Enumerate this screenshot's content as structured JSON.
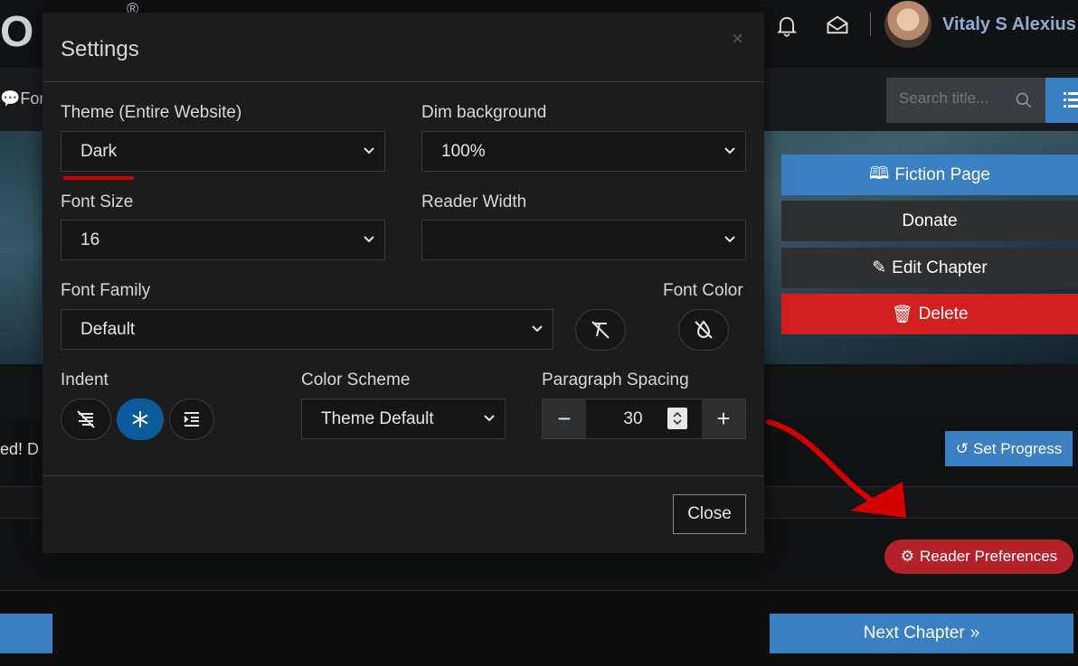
{
  "header": {
    "logo_text": "O",
    "logo_reg": "®",
    "username": "Vitaly S Alexius"
  },
  "nav": {
    "forum_label": "For",
    "search_placeholder": "Search title..."
  },
  "actions": {
    "fiction_page": "Fiction Page",
    "donate": "Donate",
    "edit_chapter": "Edit Chapter",
    "delete": "Delete"
  },
  "page": {
    "partial_text": "ed! D",
    "set_progress": "Set Progress",
    "reader_preferences": "Reader Preferences",
    "next_chapter": "Next Chapter"
  },
  "settings": {
    "title": "Settings",
    "close_x": "×",
    "theme": {
      "label": "Theme (Entire Website)",
      "value": "Dark"
    },
    "dim_background": {
      "label": "Dim background",
      "value": "100%"
    },
    "font_size": {
      "label": "Font Size",
      "value": "16"
    },
    "reader_width": {
      "label": "Reader Width",
      "value": ""
    },
    "font_family": {
      "label": "Font Family",
      "value": "Default"
    },
    "font_color": {
      "label": "Font Color"
    },
    "indent": {
      "label": "Indent"
    },
    "color_scheme": {
      "label": "Color Scheme",
      "value": "Theme Default"
    },
    "paragraph_spacing": {
      "label": "Paragraph Spacing",
      "value": "30",
      "minus": "−",
      "plus": "+"
    },
    "close_button": "Close"
  },
  "colors": {
    "accent_blue": "#3a7fc2",
    "delete_red": "#d31f1f",
    "prefs_red": "#b3222b",
    "active_indent": "#0b5a9c"
  }
}
